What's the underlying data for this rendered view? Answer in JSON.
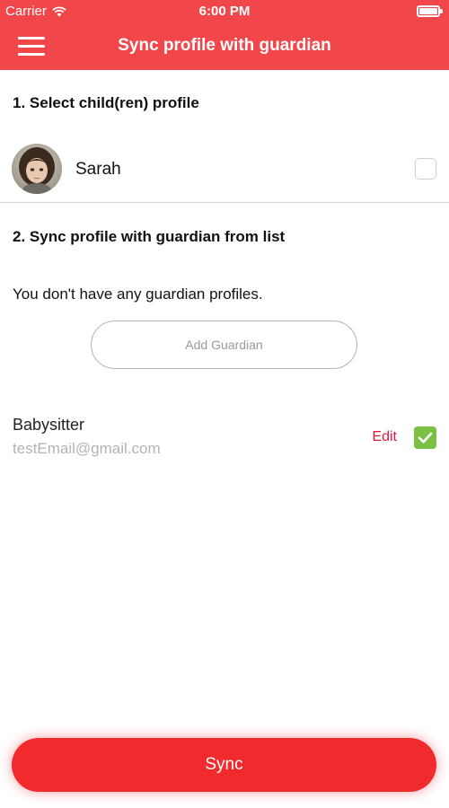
{
  "status_bar": {
    "carrier": "Carrier",
    "time": "6:00 PM",
    "wifi_icon": "wifi-icon",
    "battery_icon": "battery-icon"
  },
  "nav": {
    "title": "Sync profile with guardian",
    "menu_icon": "hamburger-menu-icon"
  },
  "section_1": {
    "heading": "1. Select child(ren) profile",
    "children": [
      {
        "name": "Sarah",
        "checked": false
      }
    ]
  },
  "section_2": {
    "heading": "2. Sync profile with guardian from list",
    "empty_message": "You don't have any guardian profiles.",
    "add_button_label": "Add Guardian",
    "guardians": [
      {
        "name": "Babysitter",
        "email": "testEmail@gmail.com",
        "edit_label": "Edit",
        "checked": true
      }
    ]
  },
  "sync_button_label": "Sync",
  "colors": {
    "brand_red": "#f2474a",
    "button_red": "#f02a2d",
    "edit_red": "#e5173f",
    "check_green": "#7ac143"
  }
}
